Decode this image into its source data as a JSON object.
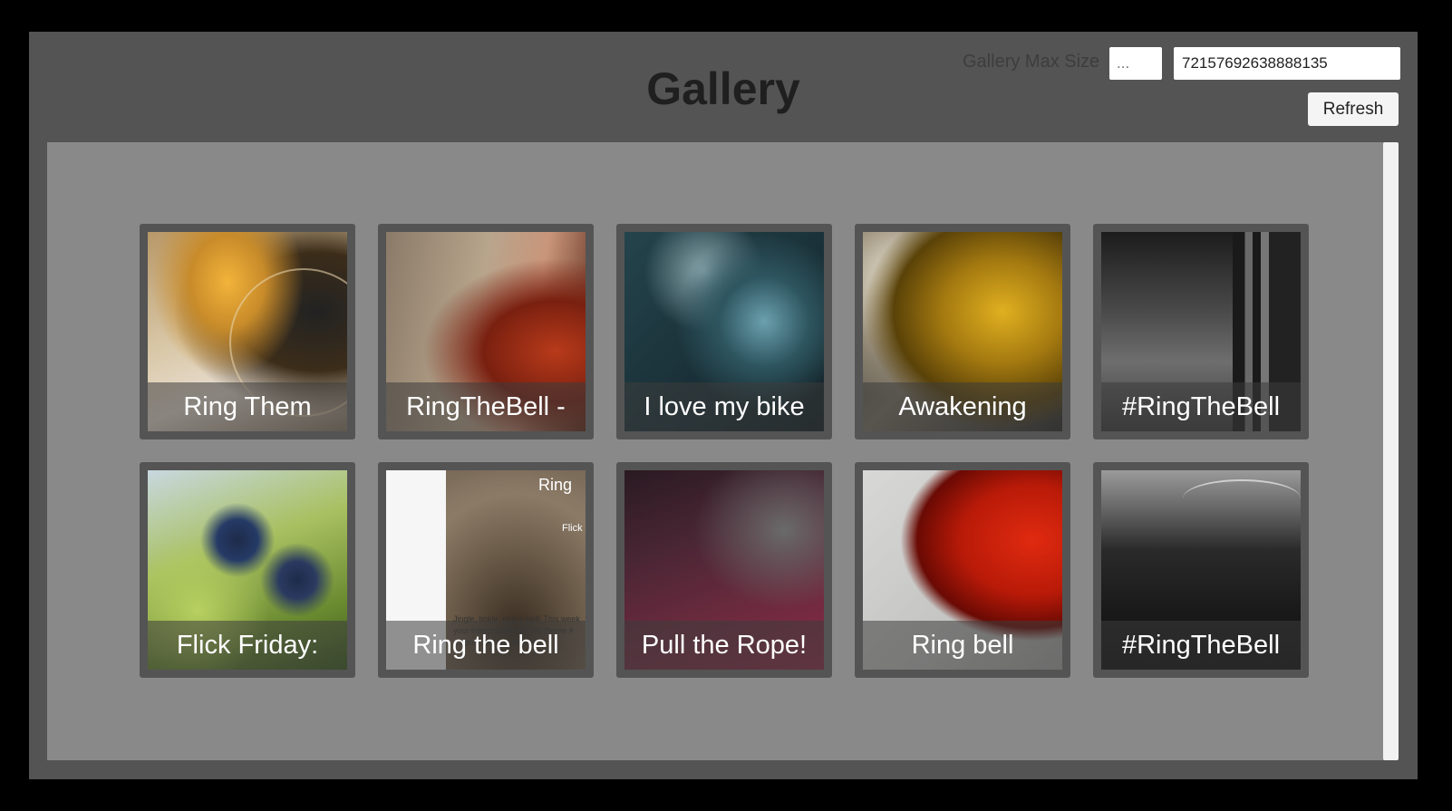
{
  "header": {
    "title": "Gallery",
    "max_size_label": "Gallery Max Size",
    "max_size_placeholder": "...",
    "gallery_id_value": "72157692638888135",
    "refresh_label": "Refresh"
  },
  "gallery": {
    "items": [
      {
        "caption": "Ring Them"
      },
      {
        "caption": "RingTheBell -"
      },
      {
        "caption": "I love my bike"
      },
      {
        "caption": "Awakening"
      },
      {
        "caption": "#RingTheBell"
      },
      {
        "caption": "Flick Friday:"
      },
      {
        "caption": "Ring the bell",
        "thumb_text_title": "Ring",
        "thumb_text_sub": "Flick",
        "thumb_text_body": "Jingle, tinkle, ring it well! This week your interpretation of the theme # ...upon...ediat... next w..."
      },
      {
        "caption": "Pull the Rope!"
      },
      {
        "caption": "Ring bell"
      },
      {
        "caption": "#RingTheBell"
      }
    ]
  },
  "colors": {
    "background": "#000000",
    "window": "#545454",
    "panel": "#898989",
    "tile_frame": "#545454",
    "title_text": "#1f1f1f"
  }
}
